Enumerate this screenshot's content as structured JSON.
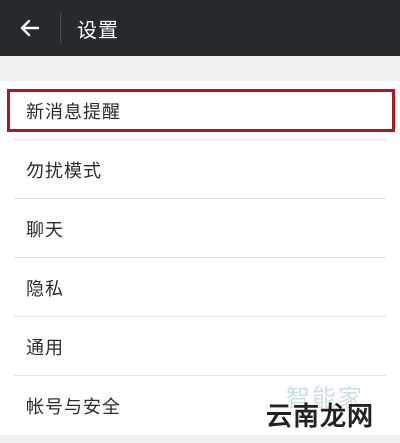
{
  "header": {
    "title": "设置",
    "back_icon": "arrow-left-icon"
  },
  "settings": {
    "items": [
      {
        "label": "新消息提醒",
        "highlighted": true
      },
      {
        "label": "勿扰模式"
      },
      {
        "label": "聊天"
      },
      {
        "label": "隐私"
      },
      {
        "label": "通用"
      },
      {
        "label": "帐号与安全"
      }
    ]
  },
  "watermark": {
    "top": "智能家",
    "bottom": "云南龙网"
  },
  "colors": {
    "header_bg": "#262a2d",
    "highlight_border": "#b0181d",
    "page_bg": "#f0f0f0"
  }
}
